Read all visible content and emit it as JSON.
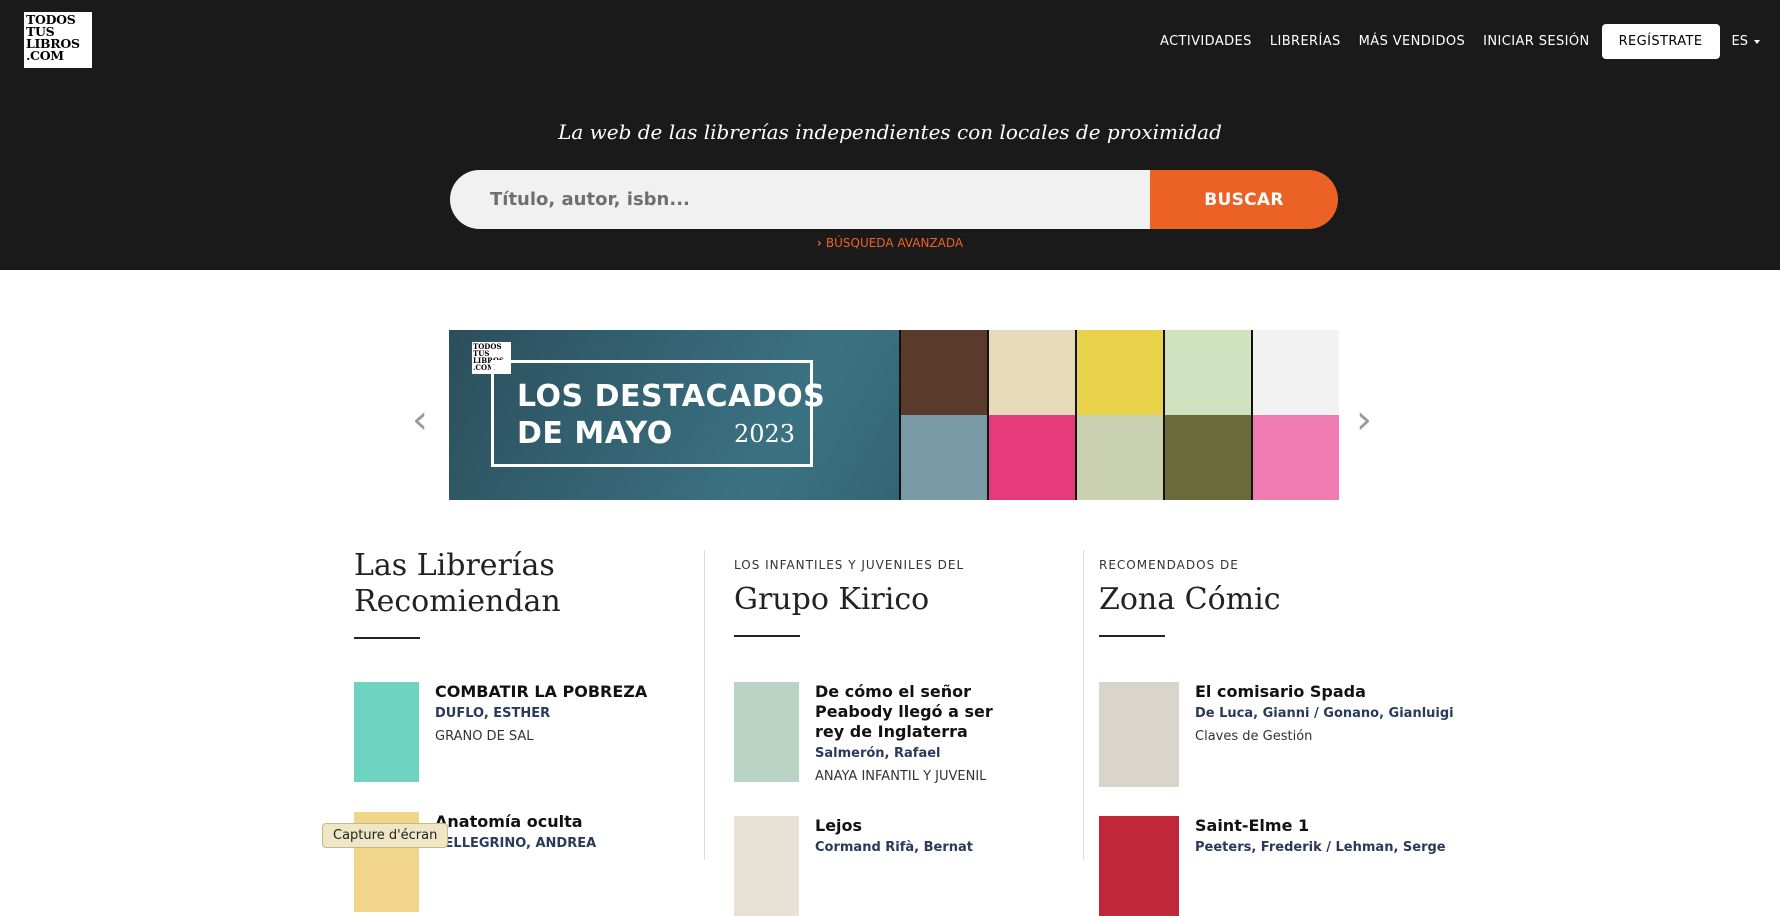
{
  "header": {
    "logo_lines": [
      "TODOS",
      "TUS",
      "LIBROS",
      ".COM"
    ],
    "nav": [
      "ACTIVIDADES",
      "LIBRERÍAS",
      "MÁS VENDIDOS",
      "INICIAR SESIÓN"
    ],
    "register_label": "REGÍSTRATE",
    "lang_label": "ES"
  },
  "hero": {
    "tagline": "La web de las librerías independientes con locales de proximidad",
    "search_placeholder": "Título, autor, isbn...",
    "search_button": "BUSCAR",
    "advanced_link": "BÚSQUEDA AVANZADA"
  },
  "banner": {
    "logo_lines": [
      "TODOS",
      "TUS",
      "LIBROS",
      ".COM"
    ],
    "line1": "LOS DESTACADOS",
    "line2": "DE MAYO",
    "year": "2023",
    "prev": "‹",
    "next": "›"
  },
  "columns": [
    {
      "kicker": "",
      "title_line1": "Las Librerías",
      "title_line2": "Recomiendan",
      "books": [
        {
          "title": "COMBATIR LA POBREZA",
          "author": "DUFLO, ESTHER",
          "publisher": "GRANO DE SAL"
        },
        {
          "title": "Anatomía oculta",
          "author": "PELLEGRINO, ANDREA",
          "publisher": ""
        }
      ]
    },
    {
      "kicker": "LOS INFANTILES Y JUVENILES DEL",
      "title_line1": "Grupo Kirico",
      "title_line2": "",
      "books": [
        {
          "title": "De cómo el señor Peabody llegó a ser rey de Inglaterra",
          "author": "Salmerón, Rafael",
          "publisher": "ANAYA INFANTIL Y JUVENIL"
        },
        {
          "title": "Lejos",
          "author": "Cormand Rifà, Bernat",
          "publisher": ""
        }
      ]
    },
    {
      "kicker": "RECOMENDADOS DE",
      "title_line1": "Zona Cómic",
      "title_line2": "",
      "books": [
        {
          "title": "El comisario Spada",
          "author": "De Luca, Gianni / Gonano, Gianluigi",
          "publisher": "Claves de Gestión"
        },
        {
          "title": "Saint-Elme 1",
          "author": "Peeters, Frederik / Lehman, Serge",
          "publisher": ""
        }
      ]
    }
  ],
  "overlay": {
    "capture_label": "Capture d'écran"
  },
  "colors": {
    "header_bg": "#1a1a1a",
    "accent": "#ec6225"
  }
}
